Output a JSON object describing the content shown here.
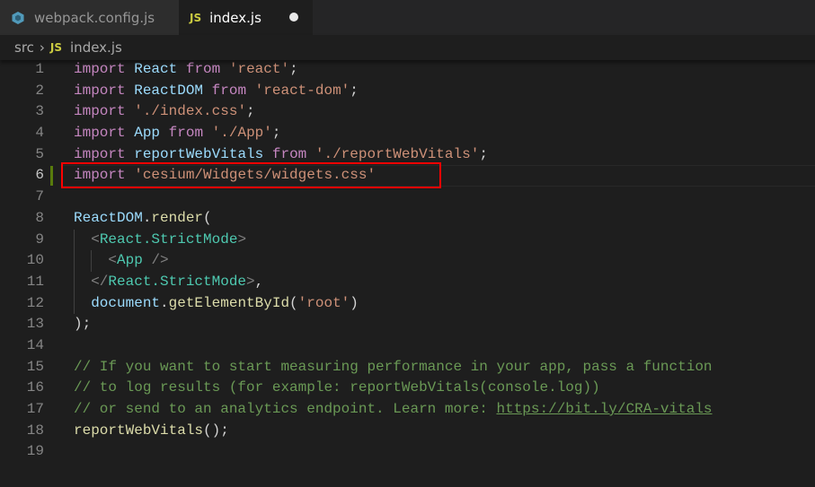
{
  "tabs": [
    {
      "label": "webpack.config.js",
      "icon": "webpack-icon",
      "active": false
    },
    {
      "label": "index.js",
      "icon": "js-icon",
      "icon_text": "JS",
      "active": true,
      "unsaved": true
    }
  ],
  "breadcrumb": {
    "folder": "src",
    "icon_text": "JS",
    "file": "index.js"
  },
  "colors": {
    "keyword": "#c586c0",
    "identifier": "#9cdcfe",
    "string": "#ce9178",
    "function": "#dcdcaa",
    "comment": "#6a9955",
    "tag": "#4ec9b0",
    "highlight_box": "#ff0000"
  },
  "current_line": 6,
  "highlighted_line": 6,
  "lines": [
    [
      [
        "kw",
        "import"
      ],
      [
        "pl",
        " "
      ],
      [
        "id",
        "React"
      ],
      [
        "pl",
        " "
      ],
      [
        "kw",
        "from"
      ],
      [
        "pl",
        " "
      ],
      [
        "str",
        "'react'"
      ],
      [
        "pl",
        ";"
      ]
    ],
    [
      [
        "kw",
        "import"
      ],
      [
        "pl",
        " "
      ],
      [
        "id",
        "ReactDOM"
      ],
      [
        "pl",
        " "
      ],
      [
        "kw",
        "from"
      ],
      [
        "pl",
        " "
      ],
      [
        "str",
        "'react-dom'"
      ],
      [
        "pl",
        ";"
      ]
    ],
    [
      [
        "kw",
        "import"
      ],
      [
        "pl",
        " "
      ],
      [
        "str",
        "'./index.css'"
      ],
      [
        "pl",
        ";"
      ]
    ],
    [
      [
        "kw",
        "import"
      ],
      [
        "pl",
        " "
      ],
      [
        "id",
        "App"
      ],
      [
        "pl",
        " "
      ],
      [
        "kw",
        "from"
      ],
      [
        "pl",
        " "
      ],
      [
        "str",
        "'./App'"
      ],
      [
        "pl",
        ";"
      ]
    ],
    [
      [
        "kw",
        "import"
      ],
      [
        "pl",
        " "
      ],
      [
        "id",
        "reportWebVitals"
      ],
      [
        "pl",
        " "
      ],
      [
        "kw",
        "from"
      ],
      [
        "pl",
        " "
      ],
      [
        "str",
        "'./reportWebVitals'"
      ],
      [
        "pl",
        ";"
      ]
    ],
    [
      [
        "kw",
        "import"
      ],
      [
        "pl",
        " "
      ],
      [
        "str",
        "'cesium/Widgets/widgets.css'"
      ]
    ],
    [],
    [
      [
        "id",
        "ReactDOM"
      ],
      [
        "pl",
        "."
      ],
      [
        "fn",
        "render"
      ],
      [
        "pl",
        "("
      ]
    ],
    [
      [
        "pl",
        "  "
      ],
      [
        "br",
        "<"
      ],
      [
        "tag",
        "React.StrictMode"
      ],
      [
        "br",
        ">"
      ]
    ],
    [
      [
        "pl",
        "    "
      ],
      [
        "br",
        "<"
      ],
      [
        "tag",
        "App"
      ],
      [
        "pl",
        " "
      ],
      [
        "br",
        "/>"
      ]
    ],
    [
      [
        "pl",
        "  "
      ],
      [
        "br",
        "</"
      ],
      [
        "tag",
        "React.StrictMode"
      ],
      [
        "br",
        ">"
      ],
      [
        "pl",
        ","
      ]
    ],
    [
      [
        "pl",
        "  "
      ],
      [
        "id",
        "document"
      ],
      [
        "pl",
        "."
      ],
      [
        "fn",
        "getElementById"
      ],
      [
        "pl",
        "("
      ],
      [
        "str",
        "'root'"
      ],
      [
        "pl",
        ")"
      ]
    ],
    [
      [
        "pl",
        ");"
      ]
    ],
    [],
    [
      [
        "cm",
        "// If you want to start measuring performance in your app, pass a function"
      ]
    ],
    [
      [
        "cm",
        "// to log results (for example: reportWebVitals(console.log))"
      ]
    ],
    [
      [
        "cm",
        "// or send to an analytics endpoint. Learn more: "
      ],
      [
        "lnk",
        "https://bit.ly/CRA-vitals"
      ]
    ],
    [
      [
        "fn",
        "reportWebVitals"
      ],
      [
        "pl",
        "();"
      ]
    ],
    []
  ]
}
